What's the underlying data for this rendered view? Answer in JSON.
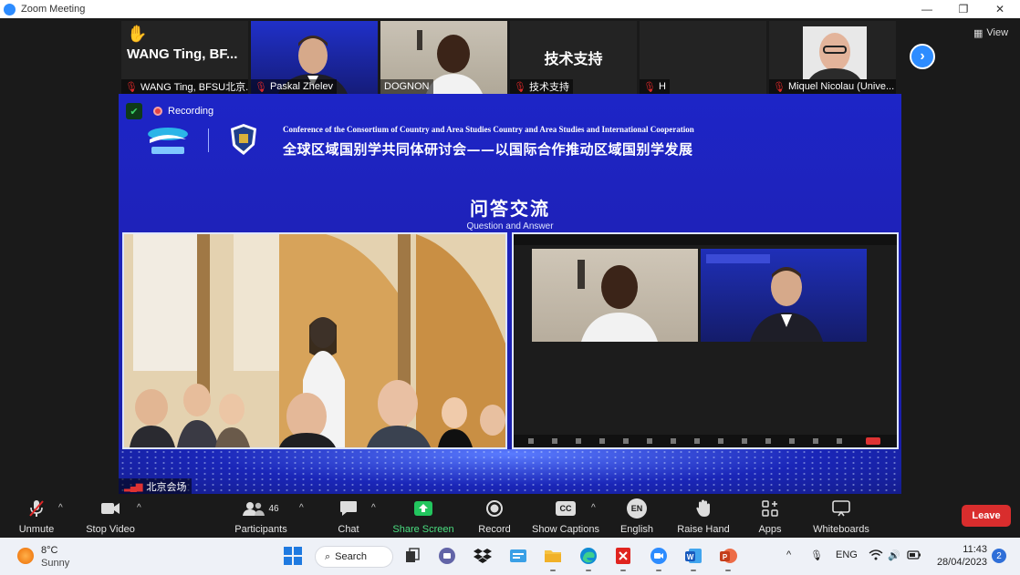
{
  "window": {
    "title": "Zoom Meeting",
    "minimize": "—",
    "restore": "❐",
    "close": "✕"
  },
  "thumbnails": [
    {
      "big_name": "WANG Ting, BF...",
      "name": "WANG Ting, BFSU北京...",
      "hand": "✋"
    },
    {
      "name": "Paskal Zhelev"
    },
    {
      "name": "DOGNON"
    },
    {
      "big_name": "技术支持",
      "name": "技术支持"
    },
    {
      "name": "H"
    },
    {
      "name": "Miquel Nicolau (Unive..."
    }
  ],
  "view_button": "View",
  "next_button": "›",
  "share": {
    "recording": "Recording",
    "conference_en": "Conference of the Consortium of Country and Area Studies Country and Area Studies and International Cooperation",
    "conference_cn": "全球区域国别学共同体研讨会——以国际合作推动区域国别学发展",
    "qa_cn": "问答交流",
    "qa_en": "Question and Answer",
    "venue_label": "北京会场"
  },
  "controls": {
    "unmute": "Unmute",
    "stop_video": "Stop Video",
    "participants": "Participants",
    "participants_count": "46",
    "chat": "Chat",
    "share_screen": "Share Screen",
    "record": "Record",
    "show_captions": "Show Captions",
    "captions_icon_text": "CC",
    "english": "English",
    "english_icon_text": "EN",
    "raise_hand": "Raise Hand",
    "apps": "Apps",
    "whiteboards": "Whiteboards",
    "leave": "Leave",
    "caret": "^"
  },
  "taskbar": {
    "temp": "8°C",
    "condition": "Sunny",
    "search": "Search",
    "lang": "ENG",
    "time": "11:43",
    "date": "28/04/2023",
    "notifications": "2",
    "tray_up": "^"
  },
  "colors": {
    "accent_blue": "#2d8cff",
    "leave_red": "#d92d2d",
    "share_green": "#22c55e",
    "slide_blue": "#1d25c7"
  }
}
